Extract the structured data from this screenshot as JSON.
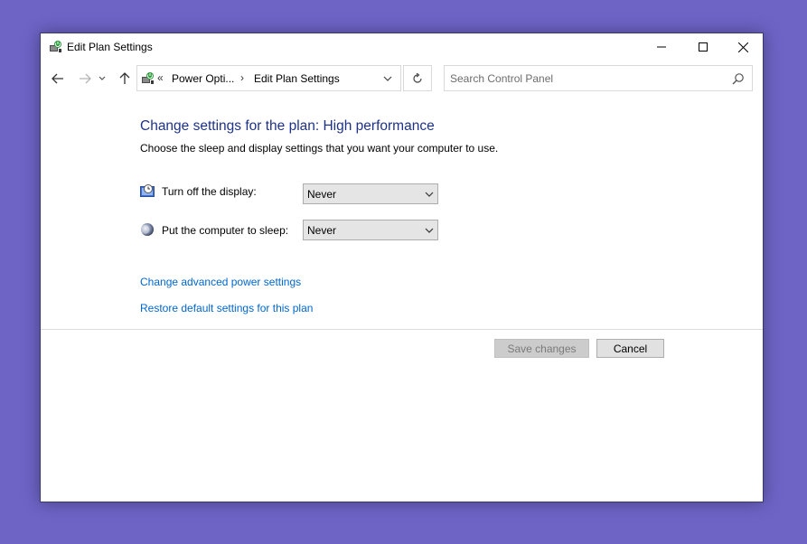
{
  "window": {
    "title": "Edit Plan Settings",
    "icon": "power-plan-icon"
  },
  "nav": {
    "address": {
      "chevron": "«",
      "crumb1": "Power Opti...",
      "separator": "›",
      "crumb2": "Edit Plan Settings"
    },
    "search": {
      "placeholder": "Search Control Panel"
    }
  },
  "main": {
    "heading": "Change settings for the plan: High performance",
    "subtext": "Choose the sleep and display settings that you want your computer to use.",
    "settings": [
      {
        "label": "Turn off the display:",
        "value": "Never",
        "icon": "display-timer-icon"
      },
      {
        "label": "Put the computer to sleep:",
        "value": "Never",
        "icon": "sleep-moon-icon"
      }
    ],
    "links": [
      "Change advanced power settings",
      "Restore default settings for this plan"
    ]
  },
  "footer": {
    "save_label": "Save changes",
    "cancel_label": "Cancel"
  },
  "colors": {
    "desktop": "#6d64c6",
    "heading": "#1e3287",
    "link": "#0066cc"
  }
}
